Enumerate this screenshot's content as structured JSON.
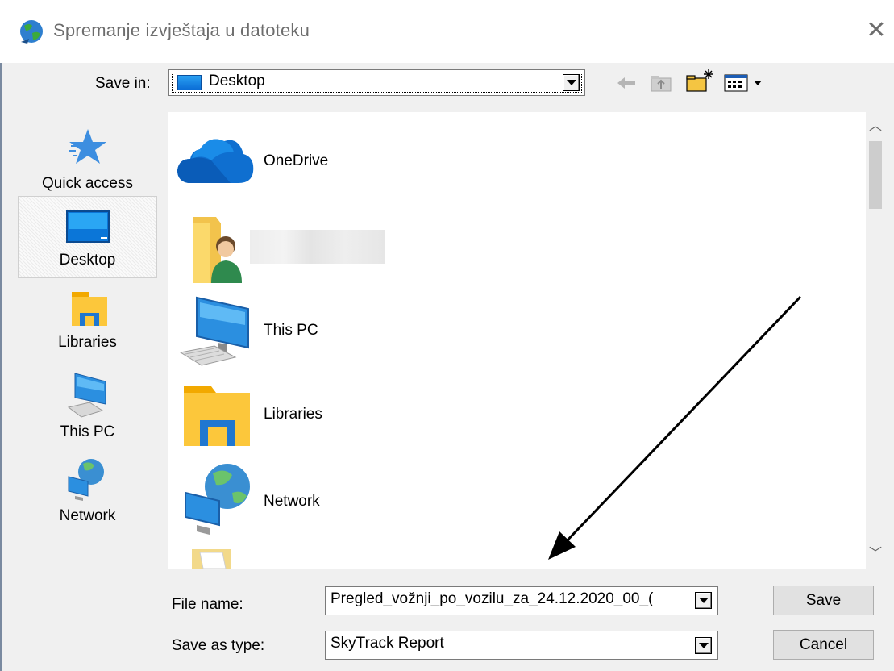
{
  "window": {
    "title": "Spremanje izvještaja u datoteku",
    "close_glyph": "✕"
  },
  "toolbar": {
    "save_in_label": "Save in:",
    "save_in_value": "Desktop",
    "icons": [
      "back-arrow-icon",
      "up-folder-icon",
      "new-folder-icon",
      "view-menu-icon"
    ]
  },
  "places": [
    {
      "label": "Quick access",
      "icon": "star-icon"
    },
    {
      "label": "Desktop",
      "icon": "desktop-icon",
      "selected": true
    },
    {
      "label": "Libraries",
      "icon": "libraries-icon"
    },
    {
      "label": "This PC",
      "icon": "computer-icon"
    },
    {
      "label": "Network",
      "icon": "network-icon"
    }
  ],
  "files": [
    {
      "name": "OneDrive",
      "icon": "onedrive-cloud-icon"
    },
    {
      "name": "",
      "icon": "user-folder-icon"
    },
    {
      "name": "This PC",
      "icon": "computer-icon"
    },
    {
      "name": "Libraries",
      "icon": "libraries-folder-icon"
    },
    {
      "name": "Network",
      "icon": "network-globe-icon"
    },
    {
      "name": "",
      "icon": "folder-icon"
    }
  ],
  "footer": {
    "file_name_label": "File name:",
    "file_name_value": "Pregled_vožnji_po_vozilu_za_24.12.2020_00_(",
    "save_type_label": "Save as type:",
    "save_type_value": "SkyTrack Report",
    "save_button": "Save",
    "cancel_button": "Cancel"
  },
  "colors": {
    "accent": "#0078d7",
    "window_bg": "#f0f0f0",
    "list_bg": "#ffffff"
  }
}
